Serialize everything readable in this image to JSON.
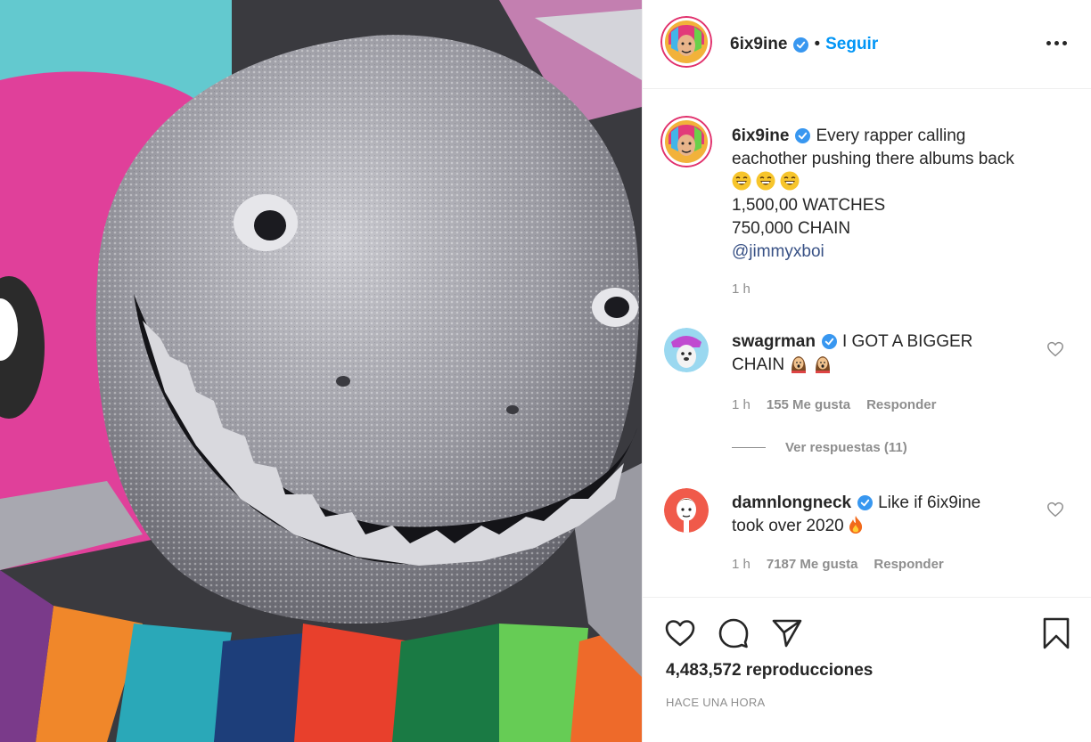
{
  "post": {
    "username": "6ix9ine",
    "separator": "•",
    "follow_label": "Seguir"
  },
  "caption": {
    "username": "6ix9ine",
    "line1": "Every rapper calling",
    "line2": "eachother pushing there albums back",
    "emoji_count": 3,
    "line3": "1,500,00 WATCHES",
    "line4": "750,000 CHAIN",
    "mention": "@jimmyxboi",
    "time": "1 h"
  },
  "comments": [
    {
      "username": "swagrman",
      "text_line1": "I GOT A BIGGER",
      "text_line2": "CHAIN",
      "time": "1 h",
      "likes": "155 Me gusta",
      "reply": "Responder",
      "view_replies": "Ver respuestas (11)"
    },
    {
      "username": "damnlongneck",
      "text_line1": "Like if 6ix9ine",
      "text_line2": "took over 2020",
      "time": "1 h",
      "likes": "7187 Me gusta",
      "reply": "Responder"
    }
  ],
  "stats": {
    "views": "4,483,572 reproducciones",
    "posted": "HACE UNA HORA"
  },
  "icons": {
    "more": "more-options-icon",
    "like": "heart-icon",
    "comment": "comment-icon",
    "share": "share-icon",
    "save": "bookmark-icon",
    "verified": "verified-badge-icon"
  },
  "colors": {
    "accent": "#0095f6",
    "mention": "#385185",
    "verified": "#3897f0",
    "muted": "#8e8e8e",
    "text": "#262626"
  }
}
